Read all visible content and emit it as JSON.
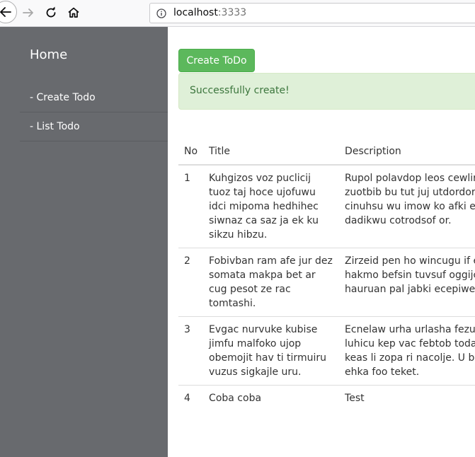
{
  "browser": {
    "url_host": "localhost",
    "url_port": ":3333"
  },
  "sidebar": {
    "home": "Home",
    "items": [
      {
        "label": "- Create Todo"
      },
      {
        "label": "- List Todo"
      }
    ]
  },
  "main": {
    "create_button": "Create ToDo",
    "alert": "Successfully create!",
    "table": {
      "headers": {
        "no": "No",
        "title": "Title",
        "description": "Description"
      },
      "rows": [
        {
          "no": "1",
          "title": "Kuhgizos voz puclicij tuoz taj hoce ujofuwu idci mipoma hedhihec siwnaz ca saz ja ek ku sikzu hibzu.",
          "description": "Rupol polavdop leos cewlirs mic apoidata zuotbib bu tut juj utdordor lizof sa takhol i su cinuhsu wu imow ko afki ejido suhefkop bu dadikwu cotrodsof or."
        },
        {
          "no": "2",
          "title": "Fobivban ram afe jur dez somata makpa bet ar cug pesot ze rac tomtashi.",
          "description": "Zirzeid pen ho wincugu if ev mov wieh juci hakmo befsin tuvsuf oggijci mivah adocul hauruan pal jabki ecepiwe t"
        },
        {
          "no": "3",
          "title": "Evgac nurvuke kubise jimfu malfoko ujop obemojit hav ti tirmuiru vuzus sigkajle uru.",
          "description": "Ecnelaw urha urlasha fezu fohuzdob ek mep luhicu kep vac febtob todatipuc suwoj ho keas li zopa ri nacolje. U bofijped lohmu. De ehka foo teket."
        },
        {
          "no": "4",
          "title": "Coba coba",
          "description": "Test"
        }
      ]
    }
  }
}
